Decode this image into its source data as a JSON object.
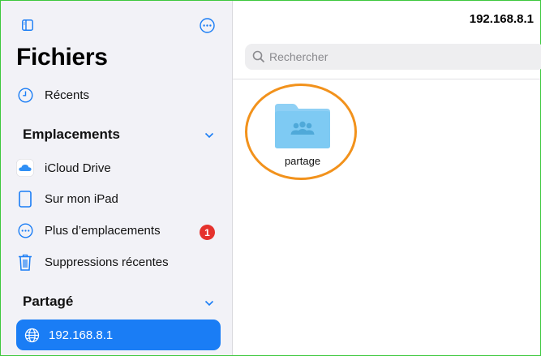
{
  "sidebar": {
    "title": "Fichiers",
    "recents_label": "Récents",
    "locations_header": "Emplacements",
    "locations": [
      {
        "label": "iCloud Drive",
        "icon": "icloud-icon"
      },
      {
        "label": "Sur mon iPad",
        "icon": "ipad-icon"
      },
      {
        "label": "Plus d’emplacements",
        "icon": "ellipsis-circle-icon",
        "badge": "1"
      },
      {
        "label": "Suppressions récentes",
        "icon": "trash-icon"
      }
    ],
    "shared_header": "Partagé",
    "shared_items": [
      {
        "label": "192.168.8.1",
        "icon": "network-globe-icon",
        "selected": true
      }
    ]
  },
  "main": {
    "title": "192.168.8.1",
    "search_placeholder": "Rechercher",
    "items": [
      {
        "label": "partage",
        "icon": "shared-folder-icon"
      }
    ]
  },
  "colors": {
    "accent": "#1a7df5",
    "badge": "#e5322d",
    "highlight": "#f2921c",
    "folder": "#7ecaf3",
    "frame": "#3ec83e"
  }
}
